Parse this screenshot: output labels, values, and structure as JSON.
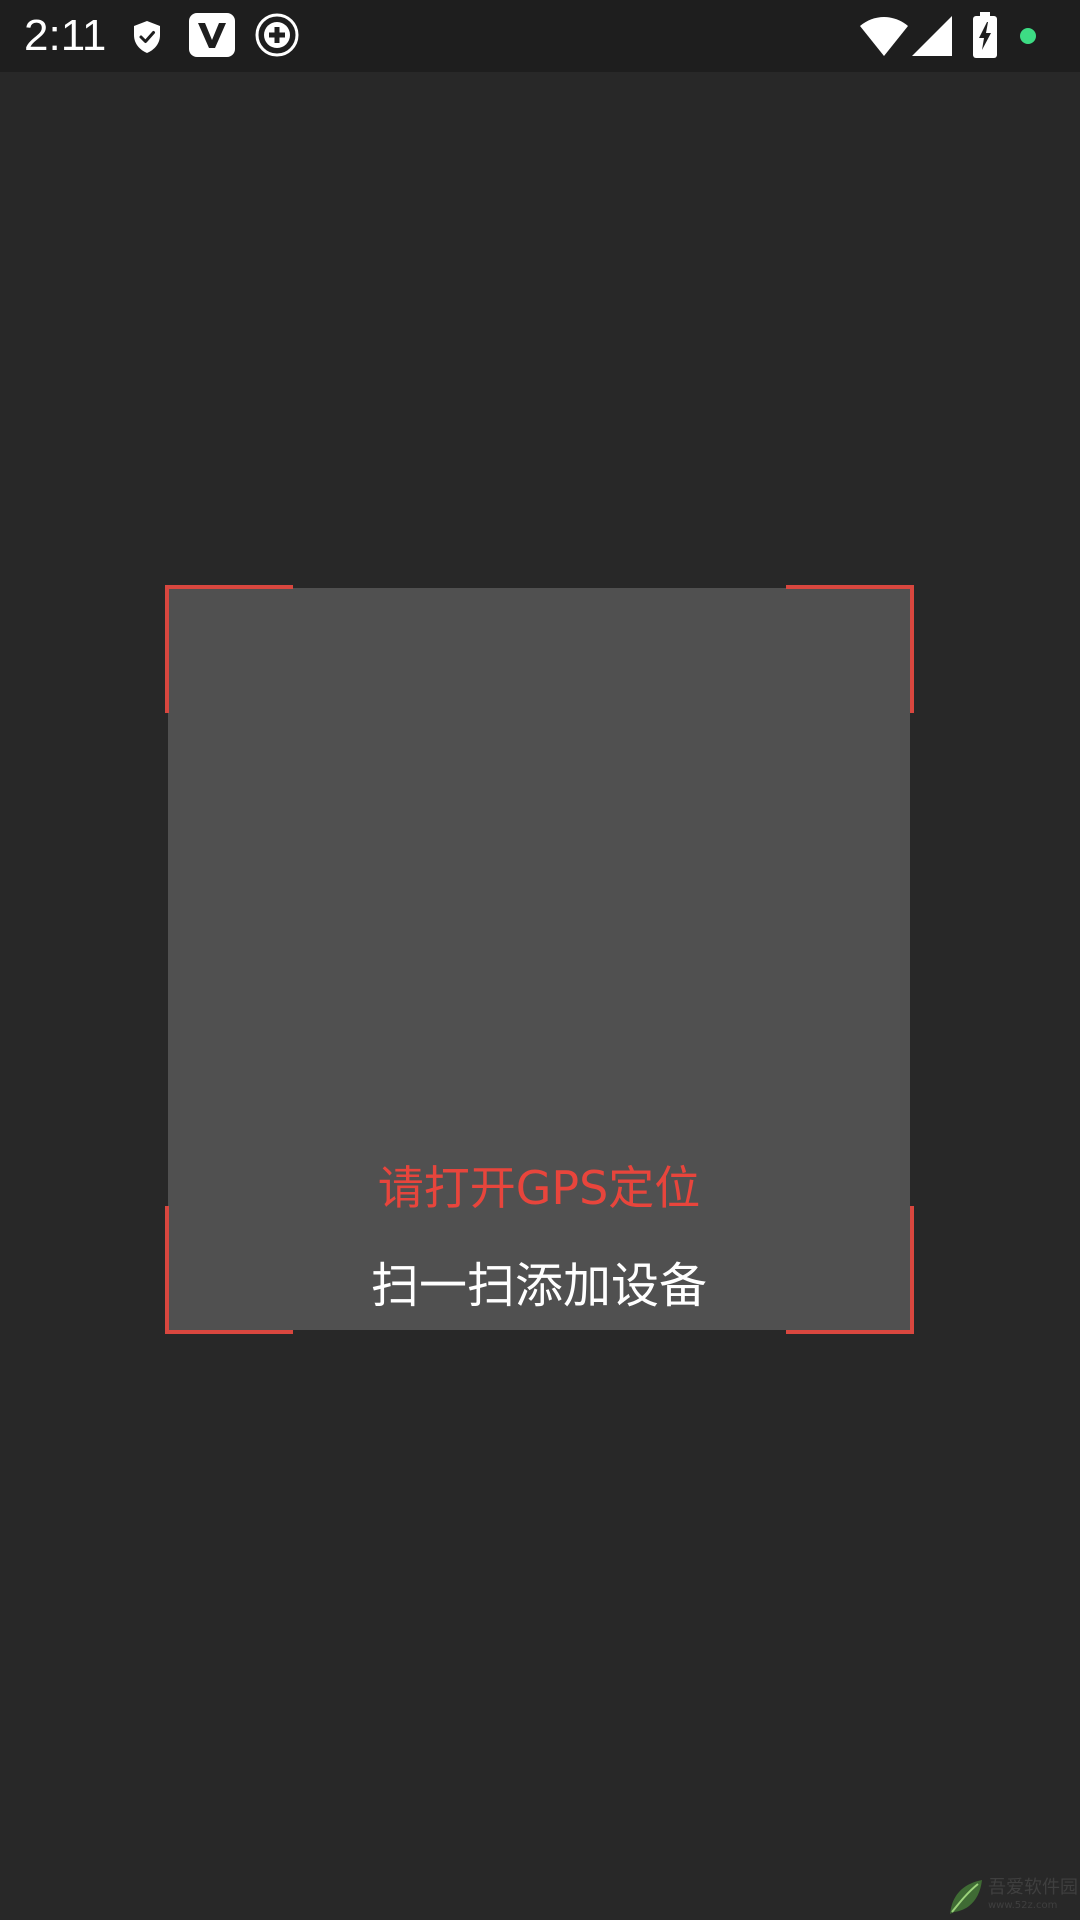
{
  "status_bar": {
    "time": "2:11",
    "left_icons": [
      "shield-icon",
      "v-app-icon",
      "plus-circle-icon"
    ],
    "right_icons": [
      "wifi-icon",
      "cellular-signal-icon",
      "battery-charging-icon",
      "green-dot"
    ],
    "dot_color": "#3ddc84"
  },
  "scanner": {
    "gps_warning": "请打开GPS定位",
    "hint": "扫一扫添加设备",
    "corner_color": "#d9473f",
    "warning_color": "#e8453c"
  },
  "watermark": {
    "name": "吾爱软件园",
    "url": "www.52z.com"
  }
}
